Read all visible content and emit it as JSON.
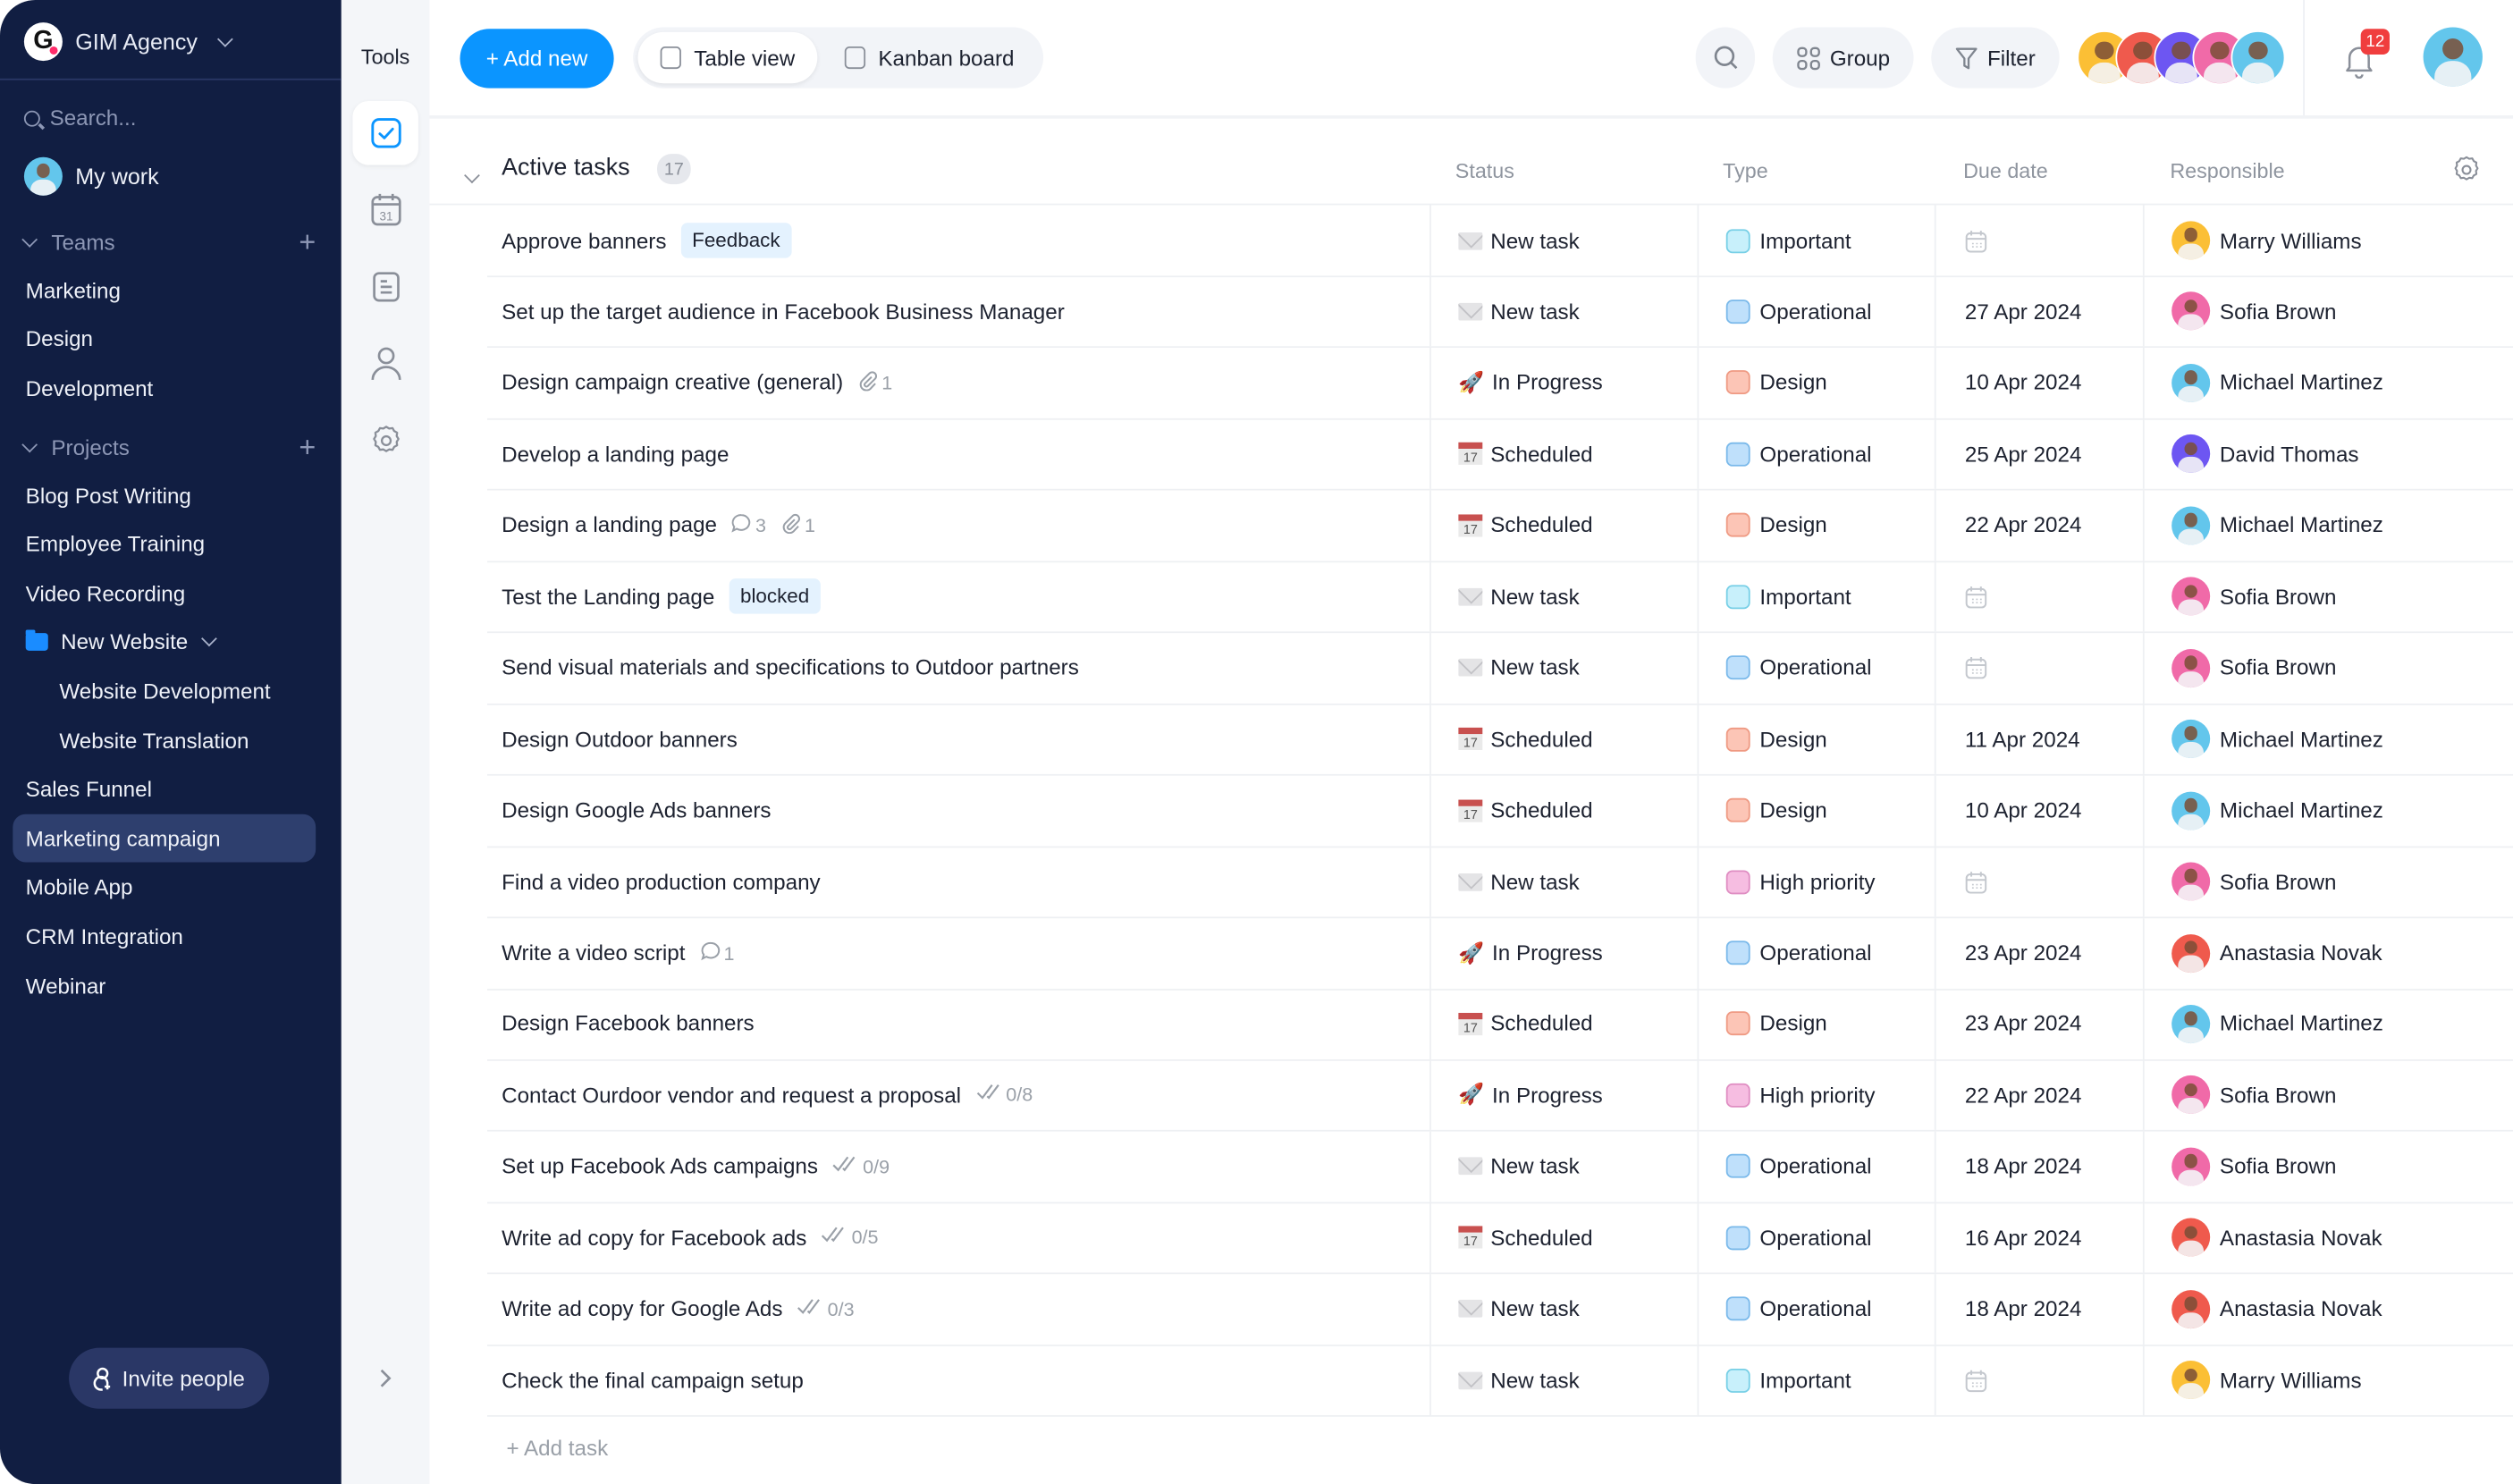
{
  "workspace": {
    "name": "GIM Agency",
    "logo_letter": "G"
  },
  "sidebar": {
    "search_placeholder": "Search...",
    "my_work": "My work",
    "teams_label": "Teams",
    "teams": [
      "Marketing",
      "Design",
      "Development"
    ],
    "projects_label": "Projects",
    "projects": [
      {
        "label": "Blog Post Writing"
      },
      {
        "label": "Employee Training"
      },
      {
        "label": "Video Recording"
      },
      {
        "label": "New Website",
        "folder": true
      },
      {
        "label": "Website Development",
        "sub": true
      },
      {
        "label": "Website Translation",
        "sub": true
      },
      {
        "label": "Sales Funnel"
      },
      {
        "label": "Marketing campaign",
        "active": true
      },
      {
        "label": "Mobile App"
      },
      {
        "label": "CRM Integration"
      },
      {
        "label": "Webinar"
      }
    ],
    "invite_label": "Invite people"
  },
  "tools": {
    "title": "Tools",
    "items": [
      "tasks-icon",
      "calendar-icon",
      "notes-icon",
      "people-icon",
      "settings-icon"
    ],
    "active": "tasks-icon"
  },
  "header": {
    "add_new": "+ Add new",
    "views": [
      {
        "label": "Table view",
        "active": true
      },
      {
        "label": "Kanban board",
        "active": false
      }
    ],
    "group": "Group",
    "filter": "Filter",
    "member_avatar_colors": [
      "#fbbf35",
      "#ef5a4d",
      "#6d56f2",
      "#f06aa8",
      "#63c6ec"
    ],
    "notifications_count": "12",
    "accent": "#0b95ff"
  },
  "table": {
    "group_title": "Active tasks",
    "group_count": "17",
    "columns": [
      "Status",
      "Type",
      "Due date",
      "Responsible"
    ],
    "add_task": "+ Add task",
    "type_colors": {
      "Important": {
        "fill": "#c8f0fb",
        "border": "#77cfe6"
      },
      "Operational": {
        "fill": "#bfe0fb",
        "border": "#7ab9ea"
      },
      "Design": {
        "fill": "#fcc5b6",
        "border": "#ef9a83"
      },
      "High priority": {
        "fill": "#f6bde1",
        "border": "#df8dc2"
      }
    },
    "people_colors": {
      "Marry Williams": "#fbbf35",
      "Sofia Brown": "#f06aa8",
      "Michael Martinez": "#63c6ec",
      "David Thomas": "#6d56f2",
      "Anastasia Novak": "#ef5a4d"
    },
    "rows": [
      {
        "name": "Approve banners",
        "tag": "Feedback",
        "status": "New task",
        "type": "Important",
        "due": "",
        "resp": "Marry Williams"
      },
      {
        "name": "Set up the target audience in Facebook Business Manager",
        "status": "New task",
        "type": "Operational",
        "due": "27 Apr 2024",
        "resp": "Sofia Brown"
      },
      {
        "name": "Design campaign creative (general)",
        "attachments": "1",
        "status": "In Progress",
        "type": "Design",
        "due": "10 Apr 2024",
        "resp": "Michael Martinez"
      },
      {
        "name": "Develop a landing page",
        "status": "Scheduled",
        "type": "Operational",
        "due": "25 Apr 2024",
        "resp": "David Thomas"
      },
      {
        "name": "Design a landing page",
        "comments": "3",
        "attachments": "1",
        "status": "Scheduled",
        "type": "Design",
        "due": "22 Apr 2024",
        "resp": "Michael Martinez"
      },
      {
        "name": "Test the Landing page",
        "tag": "blocked",
        "status": "New task",
        "type": "Important",
        "due": "",
        "resp": "Sofia Brown"
      },
      {
        "name": "Send visual materials and specifications to Outdoor partners",
        "status": "New task",
        "type": "Operational",
        "due": "",
        "resp": "Sofia Brown"
      },
      {
        "name": "Design Outdoor banners",
        "status": "Scheduled",
        "type": "Design",
        "due": "11 Apr 2024",
        "resp": "Michael Martinez"
      },
      {
        "name": "Design Google Ads banners",
        "status": "Scheduled",
        "type": "Design",
        "due": "10 Apr 2024",
        "resp": "Michael Martinez"
      },
      {
        "name": "Find a video production company",
        "status": "New task",
        "type": "High priority",
        "due": "",
        "resp": "Sofia Brown"
      },
      {
        "name": "Write a video script",
        "comments": "1",
        "status": "In Progress",
        "type": "Operational",
        "due": "23 Apr 2024",
        "resp": "Anastasia Novak"
      },
      {
        "name": "Design Facebook banners",
        "status": "Scheduled",
        "type": "Design",
        "due": "23 Apr 2024",
        "resp": "Michael Martinez"
      },
      {
        "name": "Contact Ourdoor vendor and request a proposal",
        "checklist": "0/8",
        "status": "In Progress",
        "type": "High priority",
        "due": "22 Apr 2024",
        "resp": "Sofia Brown"
      },
      {
        "name": "Set up Facebook Ads campaigns",
        "checklist": "0/9",
        "status": "New task",
        "type": "Operational",
        "due": "18 Apr 2024",
        "resp": "Sofia Brown"
      },
      {
        "name": "Write ad copy for Facebook ads",
        "checklist": "0/5",
        "status": "Scheduled",
        "type": "Operational",
        "due": "16 Apr 2024",
        "resp": "Anastasia Novak"
      },
      {
        "name": "Write ad copy for Google Ads",
        "checklist": "0/3",
        "status": "New task",
        "type": "Operational",
        "due": "18 Apr 2024",
        "resp": "Anastasia Novak"
      },
      {
        "name": "Check the final campaign setup",
        "status": "New task",
        "type": "Important",
        "due": "",
        "resp": "Marry Williams"
      }
    ]
  }
}
